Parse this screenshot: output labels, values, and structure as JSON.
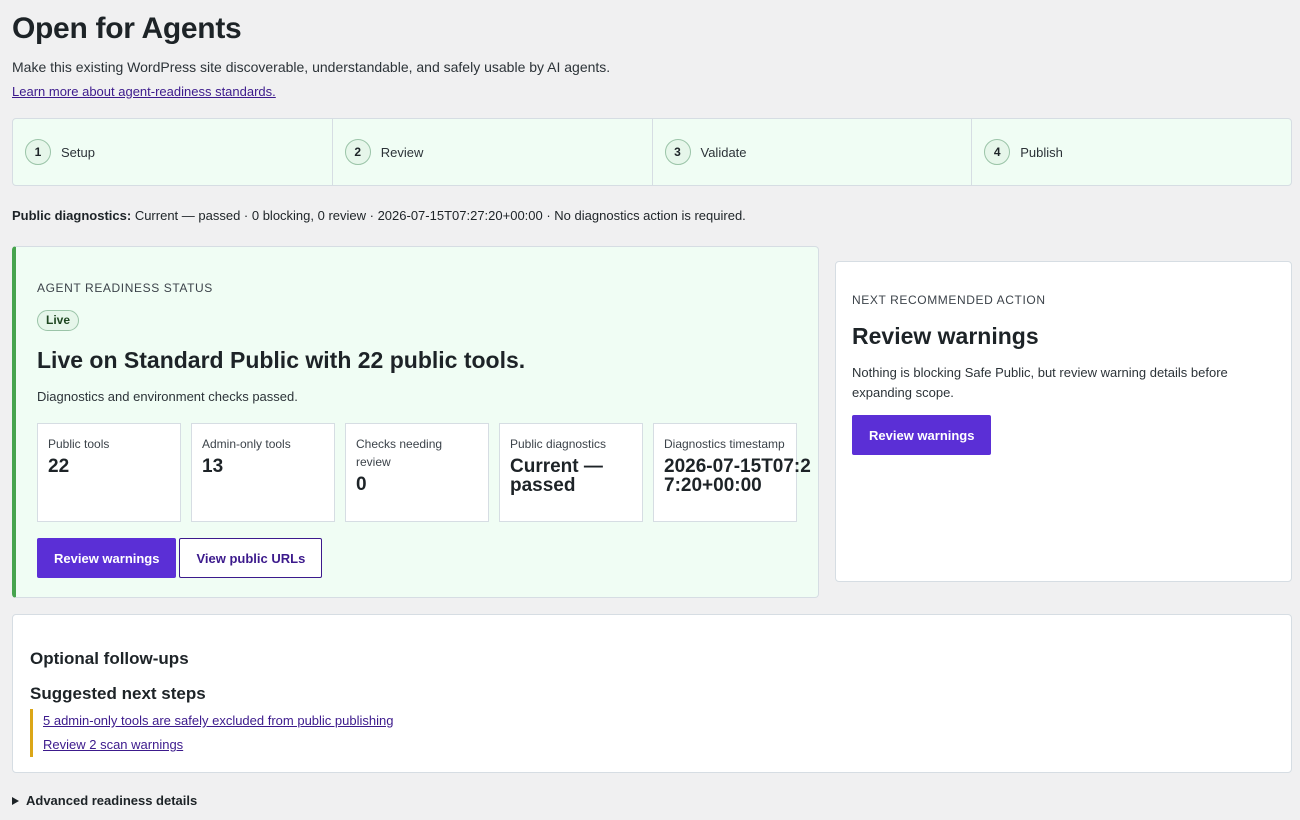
{
  "header": {
    "title": "Open for Agents",
    "description": "Make this existing WordPress site discoverable, understandable, and safely usable by AI agents.",
    "learn_more": "Learn more about agent-readiness standards."
  },
  "stepper": [
    {
      "number": "1",
      "label": "Setup"
    },
    {
      "number": "2",
      "label": "Review"
    },
    {
      "number": "3",
      "label": "Validate"
    },
    {
      "number": "4",
      "label": "Publish"
    }
  ],
  "diagnostics": {
    "label": "Public diagnostics:",
    "text": "Current — passed · 0 blocking, 0 review · 2026-07-15T07:27:20+00:00 · No diagnostics action is required."
  },
  "status_card": {
    "eyebrow": "AGENT READINESS STATUS",
    "badge": "Live",
    "headline": "Live on Standard Public with 22 public tools.",
    "subtext": "Diagnostics and environment checks passed.",
    "metrics": [
      {
        "label": "Public tools",
        "value": "22"
      },
      {
        "label": "Admin-only tools",
        "value": "13"
      },
      {
        "label": "Checks needing review",
        "value": "0"
      },
      {
        "label": "Public diagnostics",
        "value": "Current — passed"
      },
      {
        "label": "Diagnostics timestamp",
        "value": "2026-07-15T07:27:20+00:00"
      }
    ],
    "primary_button": "Review warnings",
    "secondary_button": "View public URLs",
    "accent_color": "#46a44e"
  },
  "next_action": {
    "eyebrow": "NEXT RECOMMENDED ACTION",
    "title": "Review warnings",
    "description": "Nothing is blocking Safe Public, but review warning details before expanding scope.",
    "button": "Review warnings"
  },
  "followups": {
    "title": "Optional follow-ups",
    "subtitle": "Suggested next steps",
    "items": [
      "5 admin-only tools are safely excluded from public publishing",
      "Review 2 scan warnings"
    ]
  },
  "advanced": {
    "label": "Advanced readiness details"
  },
  "colors": {
    "primary": "#5b2fd6",
    "link": "#3c1a8c",
    "success_bg": "#f0fdf4",
    "warning_border": "#dba617"
  }
}
